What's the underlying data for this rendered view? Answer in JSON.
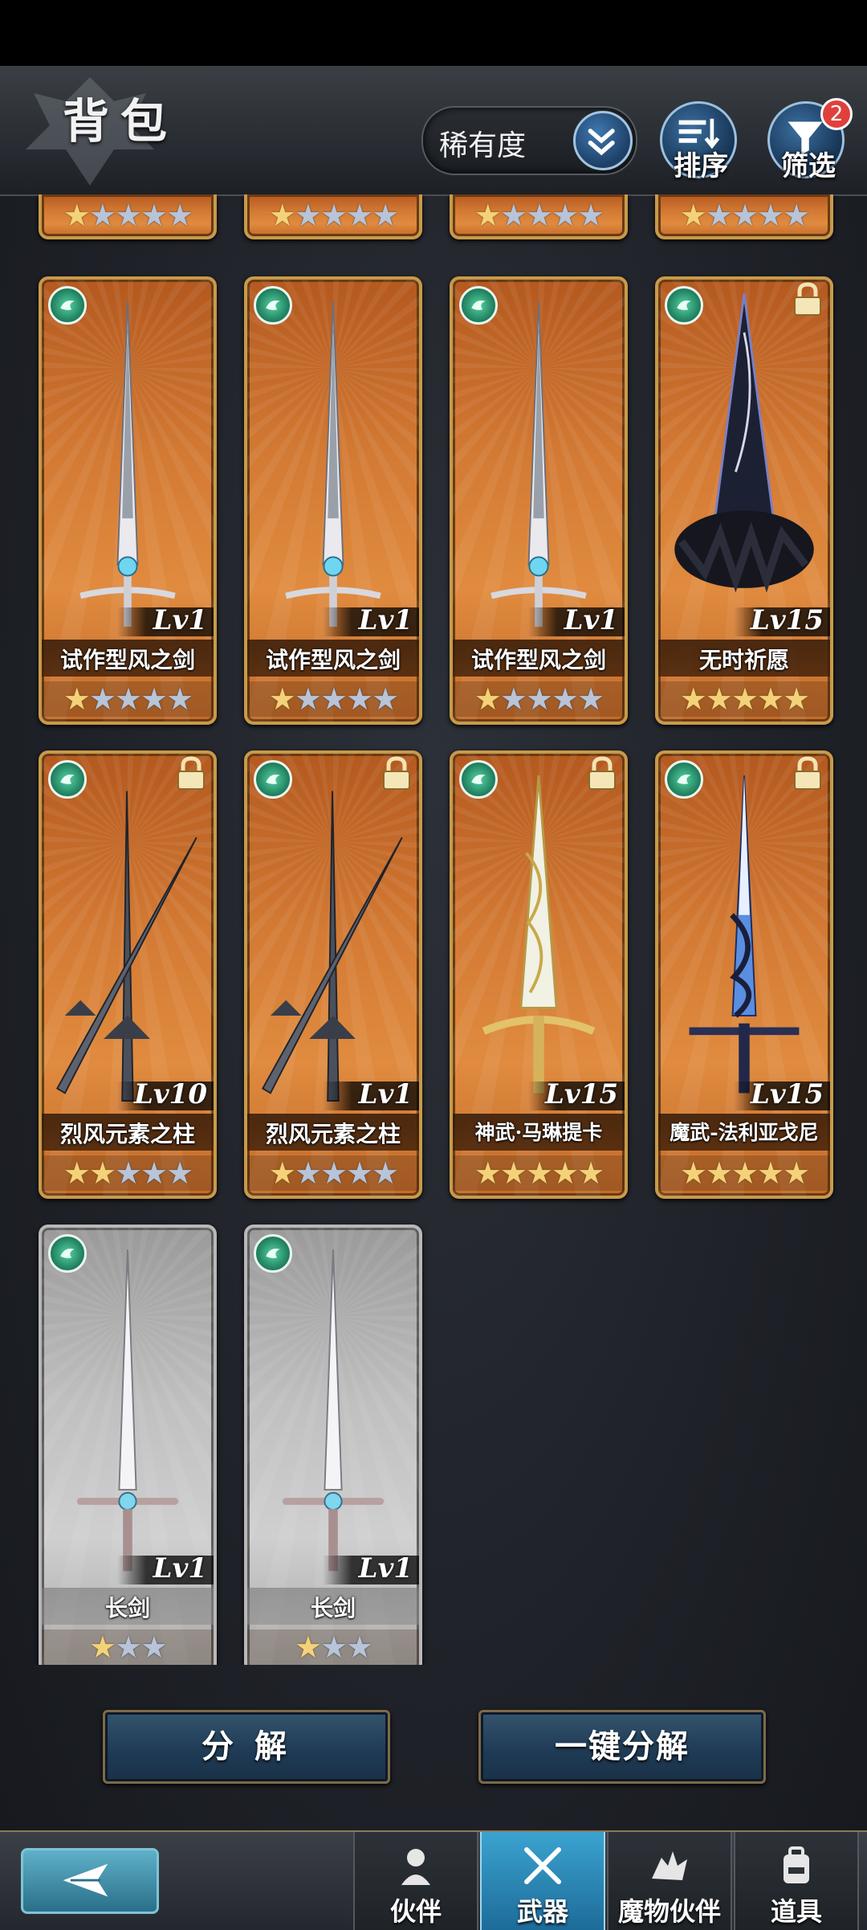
{
  "header": {
    "title": "背包",
    "sort_selected": "稀有度",
    "sort_order_label": "排序",
    "filter_label": "筛选",
    "filter_badge": "2"
  },
  "colors": {
    "card_gold": "#c89a4a",
    "card_orange": "#d37a34",
    "card_silver": "#c0c0c0",
    "element_wind": "#56d3a4",
    "nav_active": "#3ba3d0",
    "star_gold": "#f4d27a"
  },
  "partial_row": [
    {
      "stars_on": 1,
      "stars_total": 5
    },
    {
      "stars_on": 1,
      "stars_total": 5
    },
    {
      "stars_on": 1,
      "stars_total": 5
    },
    {
      "stars_on": 1,
      "stars_total": 5
    }
  ],
  "weapons": [
    {
      "name": "试作型风之剑",
      "level": "Lv1",
      "stars_on": 1,
      "stars_total": 5,
      "rarity": "gold",
      "locked": false,
      "element": "wind-icon",
      "art": "rapier"
    },
    {
      "name": "试作型风之剑",
      "level": "Lv1",
      "stars_on": 1,
      "stars_total": 5,
      "rarity": "gold",
      "locked": false,
      "element": "wind-icon",
      "art": "rapier"
    },
    {
      "name": "试作型风之剑",
      "level": "Lv1",
      "stars_on": 1,
      "stars_total": 5,
      "rarity": "gold",
      "locked": false,
      "element": "wind-icon",
      "art": "rapier"
    },
    {
      "name": "无时祈愿",
      "level": "Lv15",
      "stars_on": 5,
      "stars_total": 5,
      "rarity": "gold",
      "locked": true,
      "element": "wind-icon",
      "art": "dark-lance"
    },
    {
      "name": "烈风元素之柱",
      "level": "Lv10",
      "stars_on": 2,
      "stars_total": 5,
      "rarity": "gold",
      "locked": true,
      "element": "wind-icon",
      "art": "twin-spears"
    },
    {
      "name": "烈风元素之柱",
      "level": "Lv1",
      "stars_on": 1,
      "stars_total": 5,
      "rarity": "gold",
      "locked": true,
      "element": "wind-icon",
      "art": "twin-spears"
    },
    {
      "name": "神武·马琳提卡",
      "level": "Lv15",
      "stars_on": 5,
      "stars_total": 5,
      "rarity": "gold",
      "locked": true,
      "element": "wind-icon",
      "art": "holy-sword"
    },
    {
      "name": "魔武-法利亚戈尼",
      "level": "Lv15",
      "stars_on": 5,
      "stars_total": 5,
      "rarity": "gold",
      "locked": true,
      "element": "wind-icon",
      "art": "blue-sword"
    },
    {
      "name": "长剑",
      "level": "Lv1",
      "stars_on": 1,
      "stars_total": 3,
      "rarity": "silver",
      "locked": false,
      "element": "wind-icon",
      "art": "longsword"
    },
    {
      "name": "长剑",
      "level": "Lv1",
      "stars_on": 1,
      "stars_total": 3,
      "rarity": "silver",
      "locked": false,
      "element": "wind-icon",
      "art": "longsword"
    }
  ],
  "actions": {
    "decompose": "分 解",
    "one_click_decompose": "一键分解"
  },
  "nav": {
    "tabs": [
      {
        "label": "伙伴",
        "icon": "partner-icon",
        "active": false
      },
      {
        "label": "武器",
        "icon": "crossed-swords-icon",
        "active": true
      },
      {
        "label": "魔物伙伴",
        "icon": "monster-icon",
        "active": false
      },
      {
        "label": "道具",
        "icon": "backpack-icon",
        "active": false
      }
    ]
  }
}
